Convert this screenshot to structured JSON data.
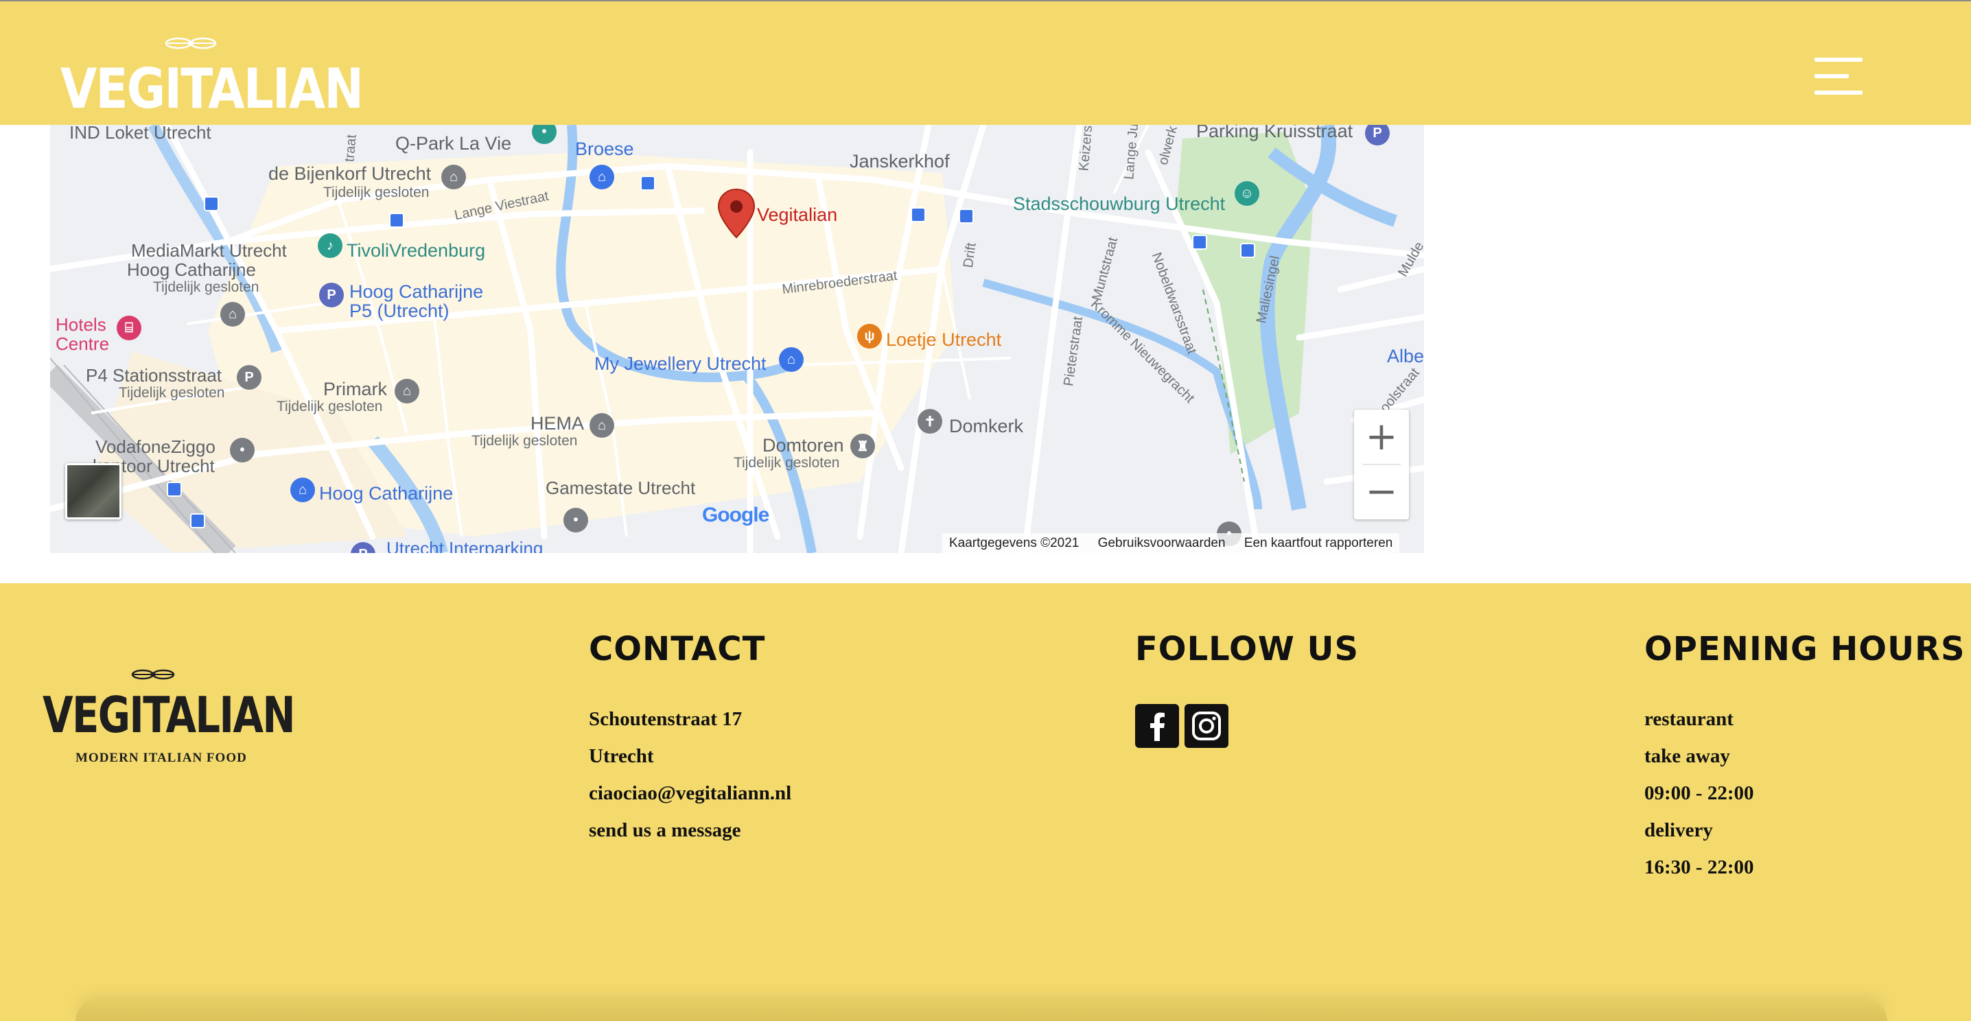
{
  "header": {
    "logo_text": "VEGITALIAN",
    "menu_icon": "hamburger-menu-icon"
  },
  "map": {
    "labels": {
      "ind_loket": "IND Loket Utrecht",
      "qpark": "Q-Park La Vie",
      "broese": "Broese",
      "janskerkhof": "Janskerkhof",
      "parking_kruis": "Parking Kruisstraat",
      "bijenkorf": "de Bijenkorf Utrecht",
      "bijenkorf_sub": "Tijdelijk gesloten",
      "vegitalian": "Vegitalian",
      "stadsschouwburg": "Stadsschouwburg Utrecht",
      "mediamarkt_1": "MediaMarkt Utrecht",
      "mediamarkt_2": "Hoog Catharijne",
      "mediamarkt_sub": "Tijdelijk gesloten",
      "tivoli": "TivoliVredenburg",
      "hoog_p5_1": "Hoog Catharijne",
      "hoog_p5_2": "P5 (Utrecht)",
      "hotels_1": "Hotels",
      "hotels_2": "Centre",
      "loetje": "Loetje Utrecht",
      "jewellery": "My Jewellery Utrecht",
      "alb": "Albe",
      "p4": "P4 Stationsstraat",
      "p4_sub": "Tijdelijk gesloten",
      "primark": "Primark",
      "primark_sub": "Tijdelijk gesloten",
      "hema": "HEMA",
      "hema_sub": "Tijdelijk gesloten",
      "domkerk": "Domkerk",
      "domtoren": "Domtoren",
      "domtoren_sub": "Tijdelijk gesloten",
      "vodafone_1": "VodafoneZiggo",
      "vodafone_2": "kantoor Utrecht",
      "hoog_cat": "Hoog Catharijne",
      "gamestate": "Gamestate Utrecht",
      "interparking": "Utrecht Interparking"
    },
    "streets": {
      "lange_viestraat": "Lange Viestraat",
      "minrebroederstraat": "Minrebroederstraat",
      "drift": "Drift",
      "muntstraat": "Muntstraat",
      "nobeldwarsstraat": "Nobeldwarsstraat",
      "maliesingel": "Maliesingel",
      "kromme": "Kromme Nieuwegracht",
      "pieterstraat": "Pieterstraat",
      "keizerstraat": "Keizers",
      "lange_jufferstraat": "Lange Juf",
      "olwerk": "olwerk",
      "schoolstraat": "Schoolstraat",
      "mulde": "Mulde",
      "straat": "traat"
    },
    "google": "Google",
    "attribution": {
      "data": "Kaartgegevens ©2021",
      "terms": "Gebruiksvoorwaarden",
      "report": "Een kaartfout rapporteren"
    },
    "zoom_in": "+",
    "zoom_out": "−"
  },
  "footer": {
    "logo_text": "VEGITALIAN",
    "logo_tagline": "MODERN ITALIAN FOOD",
    "contact": {
      "heading": "CONTACT",
      "address": "Schoutenstraat 17",
      "city": "Utrecht",
      "email": "ciaociao@vegitaliann.nl",
      "message": "send us a message"
    },
    "follow": {
      "heading": "FOLLOW US",
      "facebook": "facebook-icon",
      "instagram": "instagram-icon"
    },
    "hours": {
      "heading": "OPENING HOURS",
      "restaurant": "restaurant",
      "takeaway": "take away",
      "takeaway_hours": "09:00 - 22:00",
      "delivery": "delivery",
      "delivery_hours": "16:30 - 22:00"
    }
  },
  "colors": {
    "brand_yellow": "#f4da6d",
    "text_dark": "#111111",
    "map_pin_red": "#db4437"
  }
}
